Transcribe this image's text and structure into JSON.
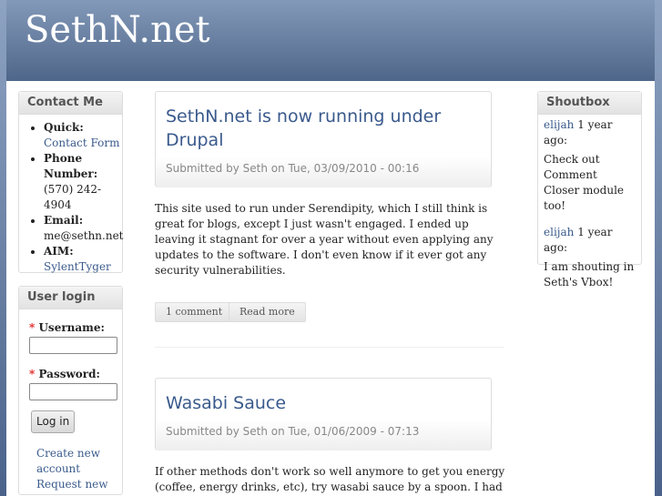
{
  "site_name": "SethN.net",
  "contact": {
    "title": "Contact Me",
    "items": [
      {
        "label": "Quick:",
        "value": "Contact Form"
      },
      {
        "label": "Phone Number:",
        "value": "(570) 242-4904"
      },
      {
        "label": "Email:",
        "value": "me@sethn.net"
      },
      {
        "label": "AIM:",
        "value": "SylentTyger"
      }
    ]
  },
  "login": {
    "title": "User login",
    "required": "*",
    "username_label": "Username:",
    "password_label": "Password:",
    "submit": "Log in",
    "create": "Create new account",
    "request": "Request new"
  },
  "posts": [
    {
      "title": "SethN.net is now running under Drupal",
      "submitted": "Submitted by Seth on Tue, 03/09/2010 - 00:16",
      "body": "This site used to run under Serendipity, which I still think is great for blogs, except I just wasn't engaged. I ended up leaving it stagnant for over a year without even applying any updates to the software. I don't even know if it ever got any security vulnerabilities.",
      "comments": "1 comment",
      "read_more": "Read more"
    },
    {
      "title": "Wasabi Sauce",
      "submitted": "Submitted by Seth on Tue, 01/06/2009 - 07:13",
      "body": "If other methods don't work so well anymore to get you energy (coffee, energy drinks, etc), try wasabi sauce by a spoon. I had a"
    }
  ],
  "shoutbox": {
    "title": "Shoutbox",
    "shouts": [
      {
        "user": "elijah",
        "time": "1 year ago:",
        "message": "Check out Comment Closer module too!"
      },
      {
        "user": "elijah",
        "time": "1 year ago:",
        "message": "I am shouting in Seth's Vbox!"
      }
    ]
  }
}
